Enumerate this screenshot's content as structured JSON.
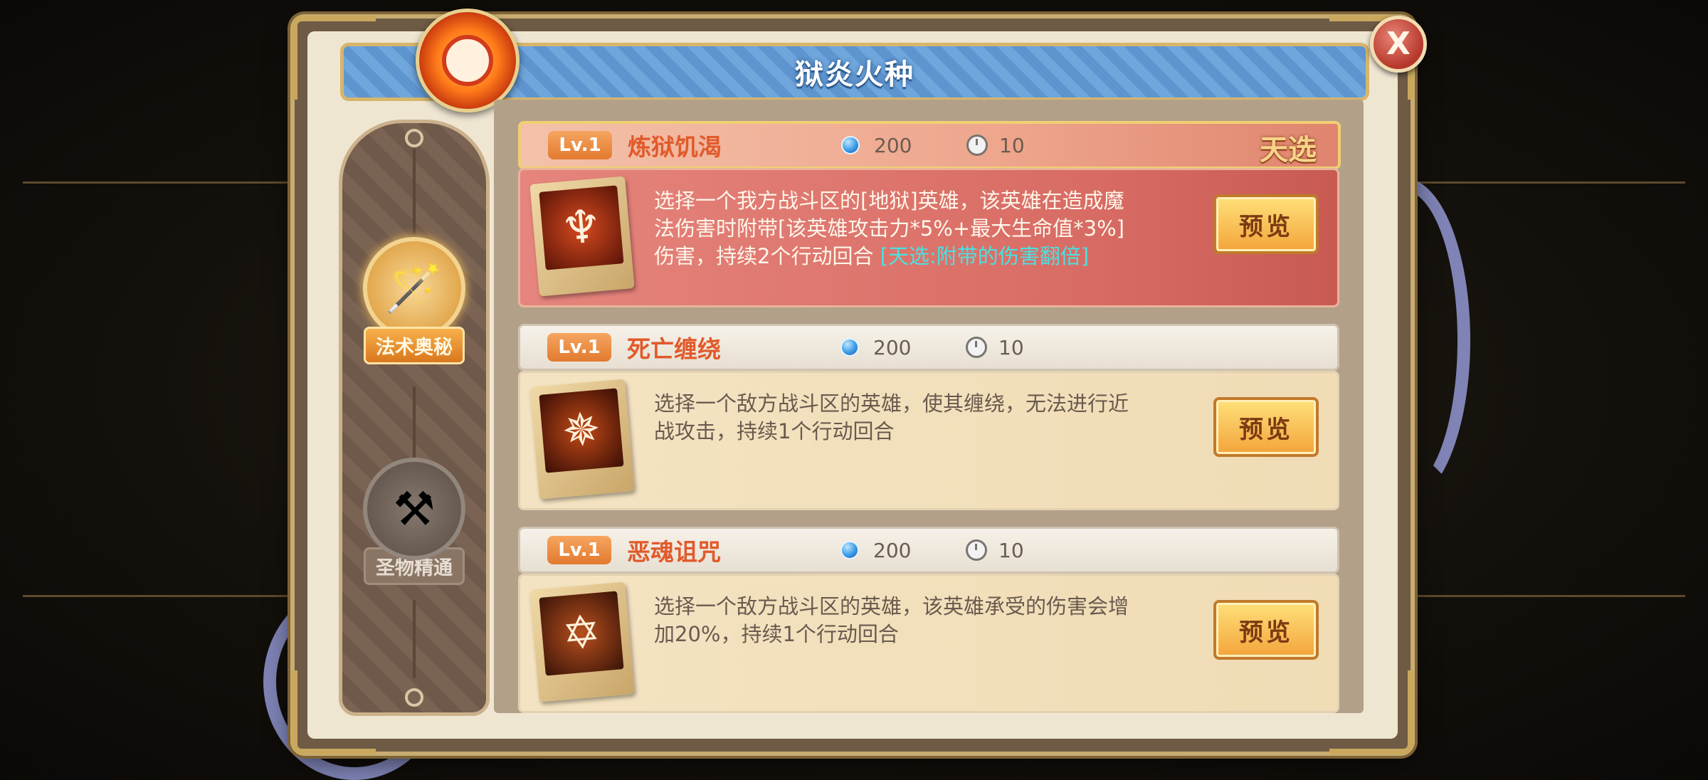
{
  "window": {
    "title": "狱炎火种"
  },
  "colors": {
    "title_bar": "#6fa6dc",
    "name_text": "#e15a2b",
    "bonus_text": "#48e2e2",
    "button_gold": "#f3a43a"
  },
  "sidebar": {
    "categories": [
      {
        "label": "法术奥秘",
        "icon": "staff-icon",
        "active": true
      },
      {
        "label": "圣物精通",
        "icon": "crossed-hammers-icon",
        "active": false
      }
    ]
  },
  "skills": [
    {
      "level": "Lv.1",
      "name": "炼狱饥渴",
      "cost": "200",
      "turns": "10",
      "tag": "天选",
      "description": "选择一个我方战斗区的[地狱]英雄，该英雄在造成魔法伤害时附带[该英雄攻击力*5%+最大生命值*3%]伤害，持续2个行动回合",
      "bonus": "[天选:附带的伤害翻倍]",
      "button": "预览",
      "icon": "trident-icon"
    },
    {
      "level": "Lv.1",
      "name": "死亡缠绕",
      "cost": "200",
      "turns": "10",
      "description": "选择一个敌方战斗区的英雄，使其缠绕，无法进行近战攻击，持续1个行动回合",
      "button": "预览",
      "icon": "spider-icon"
    },
    {
      "level": "Lv.1",
      "name": "恶魂诅咒",
      "cost": "200",
      "turns": "10",
      "description": "选择一个敌方战斗区的英雄，该英雄承受的伤害会增加20%，持续1个行动回合",
      "button": "预览",
      "icon": "hexagram-icon"
    }
  ],
  "close": {
    "label": "X"
  }
}
